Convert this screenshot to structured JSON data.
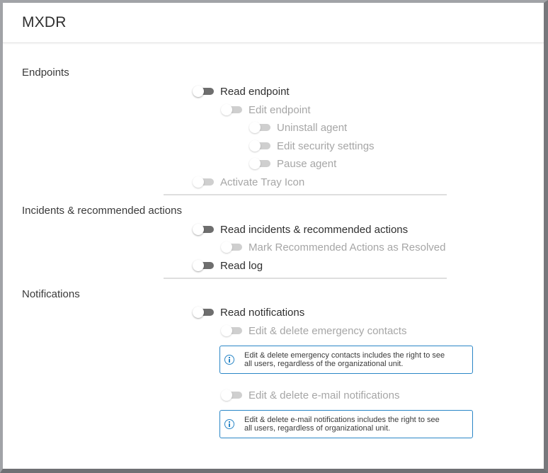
{
  "header": {
    "title": "MXDR"
  },
  "colors": {
    "accent": "#2a86c7",
    "toggle_off": "#6e6e6e",
    "toggle_disabled": "#cfcfcf"
  },
  "sections": [
    {
      "label": "Endpoints",
      "items": [
        {
          "label": "Read endpoint",
          "state": "off",
          "enabled": true,
          "level": 0
        },
        {
          "label": "Edit endpoint",
          "state": "off",
          "enabled": false,
          "level": 1
        },
        {
          "label": "Uninstall agent",
          "state": "off",
          "enabled": false,
          "level": 2
        },
        {
          "label": "Edit security settings",
          "state": "off",
          "enabled": false,
          "level": 2
        },
        {
          "label": "Pause agent",
          "state": "off",
          "enabled": false,
          "level": 2
        },
        {
          "label": "Activate Tray Icon",
          "state": "off",
          "enabled": false,
          "level": 0
        }
      ]
    },
    {
      "label": "Incidents & recommended actions",
      "items": [
        {
          "label": "Read incidents & recommended actions",
          "state": "off",
          "enabled": true,
          "level": 0
        },
        {
          "label": "Mark Recommended Actions as Resolved",
          "state": "off",
          "enabled": false,
          "level": 1
        },
        {
          "label": "Read log",
          "state": "off",
          "enabled": true,
          "level": 0
        }
      ]
    },
    {
      "label": "Notifications",
      "items": [
        {
          "label": "Read notifications",
          "state": "off",
          "enabled": true,
          "level": 0
        },
        {
          "label": "Edit & delete emergency contacts",
          "state": "off",
          "enabled": false,
          "level": 1
        },
        {
          "label": "Edit & delete e-mail notifications",
          "state": "off",
          "enabled": false,
          "level": 1
        }
      ],
      "notes": [
        {
          "icon": "info-icon",
          "line1": "Edit & delete emergency contacts includes the right to see",
          "line2": "all users, regardless of the organizational unit."
        },
        {
          "icon": "info-icon",
          "line1": "Edit & delete e-mail notifications includes the right to see",
          "line2": "all users, regardless of organizational unit."
        }
      ]
    }
  ]
}
